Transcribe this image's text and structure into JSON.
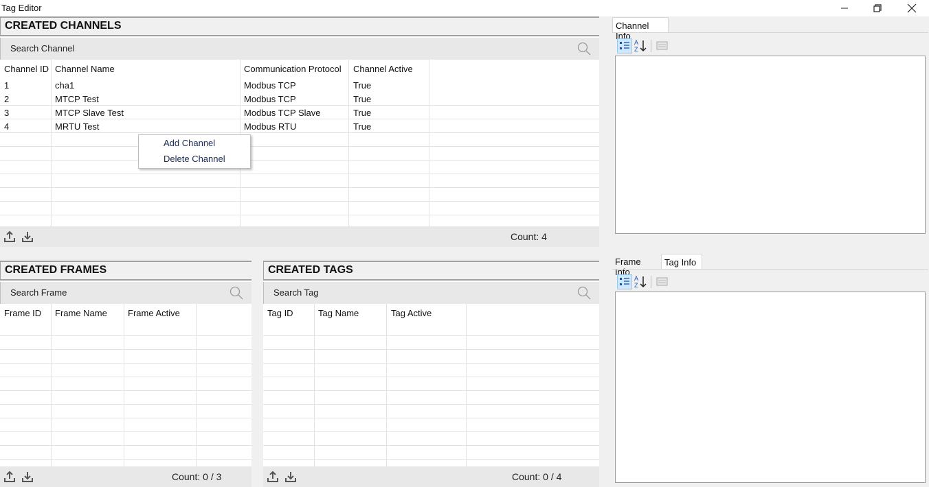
{
  "window": {
    "title": "Tag Editor",
    "minimize_icon": "minimize-icon",
    "restore_icon": "restore-icon",
    "close_icon": "close-icon"
  },
  "channels": {
    "header": "CREATED CHANNELS",
    "search_placeholder": "Search Channel",
    "columns": [
      "Channel ID",
      "Channel Name",
      "Communication Protocol",
      "Channel Active"
    ],
    "rows": [
      [
        "1",
        "cha1",
        "Modbus TCP",
        "True"
      ],
      [
        "2",
        "MTCP Test",
        "Modbus TCP",
        "True"
      ],
      [
        "3",
        "MTCP Slave Test",
        "Modbus TCP Slave",
        "True"
      ],
      [
        "4",
        "MRTU Test",
        "Modbus RTU",
        "True"
      ]
    ],
    "count": "Count: 4"
  },
  "context_menu": {
    "items": [
      "Add Channel",
      "Delete Channel"
    ]
  },
  "frames": {
    "header": "CREATED FRAMES",
    "search_placeholder": "Search Frame",
    "columns": [
      "Frame ID",
      "Frame Name",
      "Frame Active"
    ],
    "count": "Count: 0 / 3"
  },
  "tags": {
    "header": "CREATED TAGS",
    "search_placeholder": "Search Tag",
    "columns": [
      "Tag ID",
      "Tag Name",
      "Tag Active"
    ],
    "count": "Count: 0 / 4"
  },
  "channel_info": {
    "tabs": [
      "Channel Info"
    ]
  },
  "frame_tag_info": {
    "tabs": [
      "Frame Info",
      "Tag Info"
    ],
    "active_tab": "Tag Info"
  },
  "colors": {
    "accent": "#cde8ff",
    "panel": "#f0f0f0",
    "bar": "#e8e8e8",
    "menu_text": "#1a2a55"
  }
}
